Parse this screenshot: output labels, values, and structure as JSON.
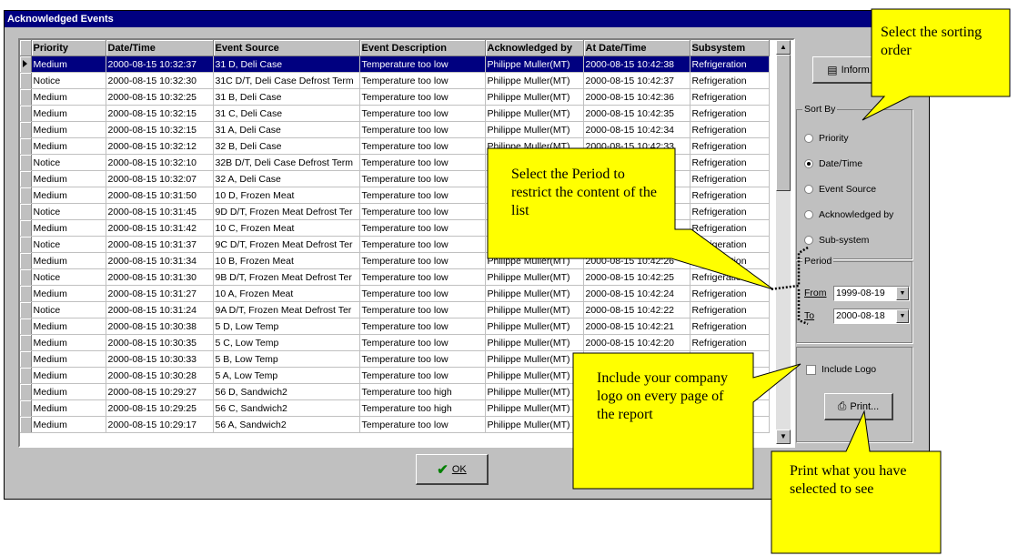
{
  "window": {
    "title": "Acknowledged Events"
  },
  "table": {
    "headers": [
      "Priority",
      "Date/Time",
      "Event Source",
      "Event Description",
      "Acknowledged by",
      "At Date/Time",
      "Subsystem"
    ],
    "rows": [
      [
        "Medium",
        "2000-08-15 10:32:37",
        "31 D, Deli Case",
        "Temperature too low",
        "Philippe Muller(MT)",
        "2000-08-15 10:42:38",
        "Refrigeration"
      ],
      [
        "Notice",
        "2000-08-15 10:32:30",
        "31C D/T, Deli Case Defrost Term",
        "Temperature too low",
        "Philippe Muller(MT)",
        "2000-08-15 10:42:37",
        "Refrigeration"
      ],
      [
        "Medium",
        "2000-08-15 10:32:25",
        "31 B, Deli Case",
        "Temperature too low",
        "Philippe Muller(MT)",
        "2000-08-15 10:42:36",
        "Refrigeration"
      ],
      [
        "Medium",
        "2000-08-15 10:32:15",
        "31 C, Deli Case",
        "Temperature too low",
        "Philippe Muller(MT)",
        "2000-08-15 10:42:35",
        "Refrigeration"
      ],
      [
        "Medium",
        "2000-08-15 10:32:15",
        "31 A, Deli Case",
        "Temperature too low",
        "Philippe Muller(MT)",
        "2000-08-15 10:42:34",
        "Refrigeration"
      ],
      [
        "Medium",
        "2000-08-15 10:32:12",
        "32 B, Deli Case",
        "Temperature too low",
        "Philippe Muller(MT)",
        "2000-08-15 10:42:33",
        "Refrigeration"
      ],
      [
        "Notice",
        "2000-08-15 10:32:10",
        "32B D/T, Deli Case Defrost Term",
        "Temperature too low",
        "",
        "",
        "Refrigeration"
      ],
      [
        "Medium",
        "2000-08-15 10:32:07",
        "32 A, Deli Case",
        "Temperature too low",
        "",
        "",
        "Refrigeration"
      ],
      [
        "Medium",
        "2000-08-15 10:31:50",
        "10 D, Frozen Meat",
        "Temperature too low",
        "",
        "",
        "Refrigeration"
      ],
      [
        "Notice",
        "2000-08-15 10:31:45",
        "9D D/T, Frozen Meat Defrost Ter",
        "Temperature too low",
        "",
        "",
        "Refrigeration"
      ],
      [
        "Medium",
        "2000-08-15 10:31:42",
        "10 C, Frozen Meat",
        "Temperature too low",
        "",
        "",
        "Refrigeration"
      ],
      [
        "Notice",
        "2000-08-15 10:31:37",
        "9C D/T, Frozen Meat Defrost Ter",
        "Temperature too low",
        "",
        "",
        "Refrigeration"
      ],
      [
        "Medium",
        "2000-08-15 10:31:34",
        "10 B, Frozen Meat",
        "Temperature too low",
        "Philippe Muller(MT)",
        "2000-08-15 10:42:26",
        "Refrigeration"
      ],
      [
        "Notice",
        "2000-08-15 10:31:30",
        "9B D/T, Frozen Meat Defrost Ter",
        "Temperature too low",
        "Philippe Muller(MT)",
        "2000-08-15 10:42:25",
        "Refrigeration"
      ],
      [
        "Medium",
        "2000-08-15 10:31:27",
        "10 A, Frozen Meat",
        "Temperature too low",
        "Philippe Muller(MT)",
        "2000-08-15 10:42:24",
        "Refrigeration"
      ],
      [
        "Notice",
        "2000-08-15 10:31:24",
        "9A D/T, Frozen Meat Defrost Ter",
        "Temperature too low",
        "Philippe Muller(MT)",
        "2000-08-15 10:42:22",
        "Refrigeration"
      ],
      [
        "Medium",
        "2000-08-15 10:30:38",
        "5 D, Low Temp",
        "Temperature too low",
        "Philippe Muller(MT)",
        "2000-08-15 10:42:21",
        "Refrigeration"
      ],
      [
        "Medium",
        "2000-08-15 10:30:35",
        "5 C, Low Temp",
        "Temperature too low",
        "Philippe Muller(MT)",
        "2000-08-15 10:42:20",
        "Refrigeration"
      ],
      [
        "Medium",
        "2000-08-15 10:30:33",
        "5 B, Low Temp",
        "Temperature too low",
        "Philippe Muller(MT)",
        "",
        ""
      ],
      [
        "Medium",
        "2000-08-15 10:30:28",
        "5 A, Low Temp",
        "Temperature too low",
        "Philippe Muller(MT)",
        "",
        ""
      ],
      [
        "Medium",
        "2000-08-15 10:29:27",
        "56 D, Sandwich2",
        "Temperature too high",
        "Philippe Muller(MT)",
        "",
        ""
      ],
      [
        "Medium",
        "2000-08-15 10:29:25",
        "56 C, Sandwich2",
        "Temperature too high",
        "Philippe Muller(MT)",
        "",
        ""
      ],
      [
        "Medium",
        "2000-08-15 10:29:17",
        "56 A, Sandwich2",
        "Temperature too low",
        "Philippe Muller(MT)",
        "",
        ""
      ]
    ]
  },
  "buttons": {
    "information": "Inform",
    "print": "Print...",
    "ok": "OK"
  },
  "sort_by": {
    "label": "Sort By",
    "options": [
      "Priority",
      "Date/Time",
      "Event Source",
      "Acknowledged by",
      "Sub-system"
    ],
    "selected": "Date/Time"
  },
  "period": {
    "label": "Period",
    "from_label": "From",
    "to_label": "To",
    "from": "1999-08-19",
    "to": "2000-08-18"
  },
  "logo": {
    "label": "Include Logo",
    "checked": false
  },
  "callouts": {
    "sorting": "Select the sorting order",
    "period": "Select the Period to restrict the content of the list",
    "logo": "Include your company logo on every page of the report",
    "print": "Print what you have selected to see"
  },
  "colors": {
    "titlebar": "#000080",
    "dialog": "#c0c0c0",
    "selection": "#000080",
    "callout": "#ffff00"
  }
}
